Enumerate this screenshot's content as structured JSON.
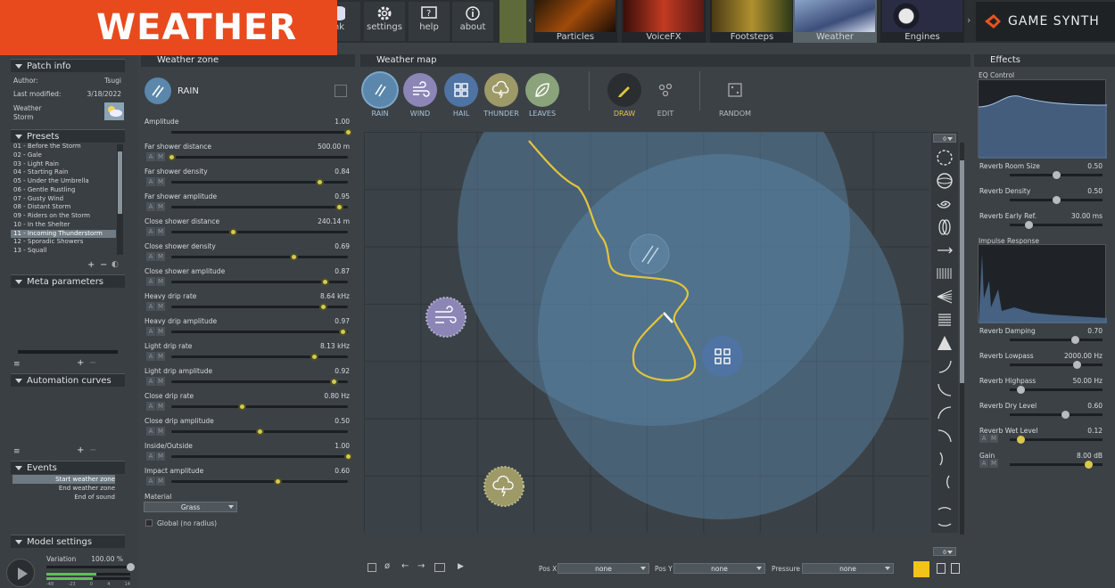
{
  "banner": "WEATHER",
  "toolbar": {
    "bank_partial": "nk",
    "settings": "settings",
    "help": "help",
    "about": "about"
  },
  "generators": [
    {
      "label": "Particles"
    },
    {
      "label": "VoiceFX"
    },
    {
      "label": "Footsteps"
    },
    {
      "label": "Weather"
    },
    {
      "label": "Engines"
    }
  ],
  "brand": "GAME SYNTH",
  "patch_info": {
    "title": "Patch info",
    "author_label": "Author:",
    "author": "Tsugi",
    "modified_label": "Last modified:",
    "modified": "3/18/2022",
    "name_line1": "Weather",
    "name_line2": "Storm"
  },
  "presets": {
    "title": "Presets",
    "items": [
      "01 - Before the Storm",
      "02 - Gale",
      "03 - Light Rain",
      "04 - Starting Rain",
      "05 - Under the Umbrella",
      "06 - Gentle Rustling",
      "07 - Gusty Wind",
      "08 - Distant Storm",
      "09 - Riders on the Storm",
      "10 - In the Shelter",
      "11 - Incoming Thunderstorm",
      "12 - Sporadic Showers",
      "13 - Squall"
    ],
    "selected": 10
  },
  "meta_parameters": {
    "title": "Meta parameters"
  },
  "automation": {
    "title": "Automation curves"
  },
  "events": {
    "title": "Events",
    "items": [
      "Start weather zone",
      "End weather zone",
      "End of sound"
    ]
  },
  "model_settings": {
    "title": "Model settings",
    "variation_label": "Variation",
    "variation_value": "100.00 %",
    "meter_ticks": [
      "-48",
      "-23",
      "0",
      "4",
      "14"
    ]
  },
  "weather_zone": {
    "title": "Weather zone",
    "zone_name": "RAIN",
    "params": [
      {
        "label": "Amplitude",
        "value": "1.00",
        "pos": 1.0,
        "am": false
      },
      {
        "label": "Far shower distance",
        "value": "500.00 m",
        "pos": 0.0,
        "am": true
      },
      {
        "label": "Far shower density",
        "value": "0.84",
        "pos": 0.84,
        "am": true
      },
      {
        "label": "Far shower amplitude",
        "value": "0.95",
        "pos": 0.95,
        "am": true
      },
      {
        "label": "Close shower distance",
        "value": "240.14 m",
        "pos": 0.35,
        "am": true
      },
      {
        "label": "Close shower density",
        "value": "0.69",
        "pos": 0.69,
        "am": true
      },
      {
        "label": "Close shower amplitude",
        "value": "0.87",
        "pos": 0.87,
        "am": true
      },
      {
        "label": "Heavy drip rate",
        "value": "8.64 kHz",
        "pos": 0.86,
        "am": true
      },
      {
        "label": "Heavy drip amplitude",
        "value": "0.97",
        "pos": 0.97,
        "am": true
      },
      {
        "label": "Light drip rate",
        "value": "8.13 kHz",
        "pos": 0.81,
        "am": true
      },
      {
        "label": "Light drip amplitude",
        "value": "0.92",
        "pos": 0.92,
        "am": true
      },
      {
        "label": "Close drip rate",
        "value": "0.80 Hz",
        "pos": 0.4,
        "am": true
      },
      {
        "label": "Close drip amplitude",
        "value": "0.50",
        "pos": 0.5,
        "am": true
      },
      {
        "label": "Inside/Outside",
        "value": "1.00",
        "pos": 1.0,
        "am": true
      },
      {
        "label": "Impact amplitude",
        "value": "0.60",
        "pos": 0.6,
        "am": true
      }
    ],
    "material_label": "Material",
    "material_value": "Grass",
    "global_label": "Global (no radius)"
  },
  "weather_map": {
    "title": "Weather map",
    "zones": [
      "RAIN",
      "WIND",
      "HAIL",
      "THUNDER",
      "LEAVES"
    ],
    "draw": "DRAW",
    "edit": "EDIT",
    "random": "RANDOM",
    "shape_counter_top": "0",
    "shape_counter_bottom": "0",
    "bottom": {
      "posx_label": "Pos X",
      "posx": "none",
      "posy_label": "Pos Y",
      "posy": "none",
      "pressure_label": "Pressure",
      "pressure": "none"
    },
    "colors": {
      "rain": "#5a87ab",
      "wind": "#8c86b7",
      "hail": "#4f73a3",
      "thunder": "#9d9a68",
      "leaves": "#8aa37a",
      "path": "#e3c43a"
    }
  },
  "effects": {
    "title": "Effects",
    "eq_label": "EQ Control",
    "ir_label": "Impulse Response",
    "params": [
      {
        "label": "Reverb Room Size",
        "value": "0.50",
        "pos": 0.5
      },
      {
        "label": "Reverb Density",
        "value": "0.50",
        "pos": 0.5
      },
      {
        "label": "Reverb Early Ref.",
        "value": "30.00 ms",
        "pos": 0.2
      },
      {
        "label": "Reverb Damping",
        "value": "0.70",
        "pos": 0.7
      },
      {
        "label": "Reverb Lowpass",
        "value": "2000.00 Hz",
        "pos": 0.72
      },
      {
        "label": "Reverb Highpass",
        "value": "50.00 Hz",
        "pos": 0.12
      },
      {
        "label": "Reverb Dry Level",
        "value": "0.60",
        "pos": 0.6
      },
      {
        "label": "Reverb Wet Level",
        "value": "0.12",
        "pos": 0.12
      },
      {
        "label": "Gain",
        "value": "8.00 dB",
        "pos": 0.85
      }
    ]
  }
}
